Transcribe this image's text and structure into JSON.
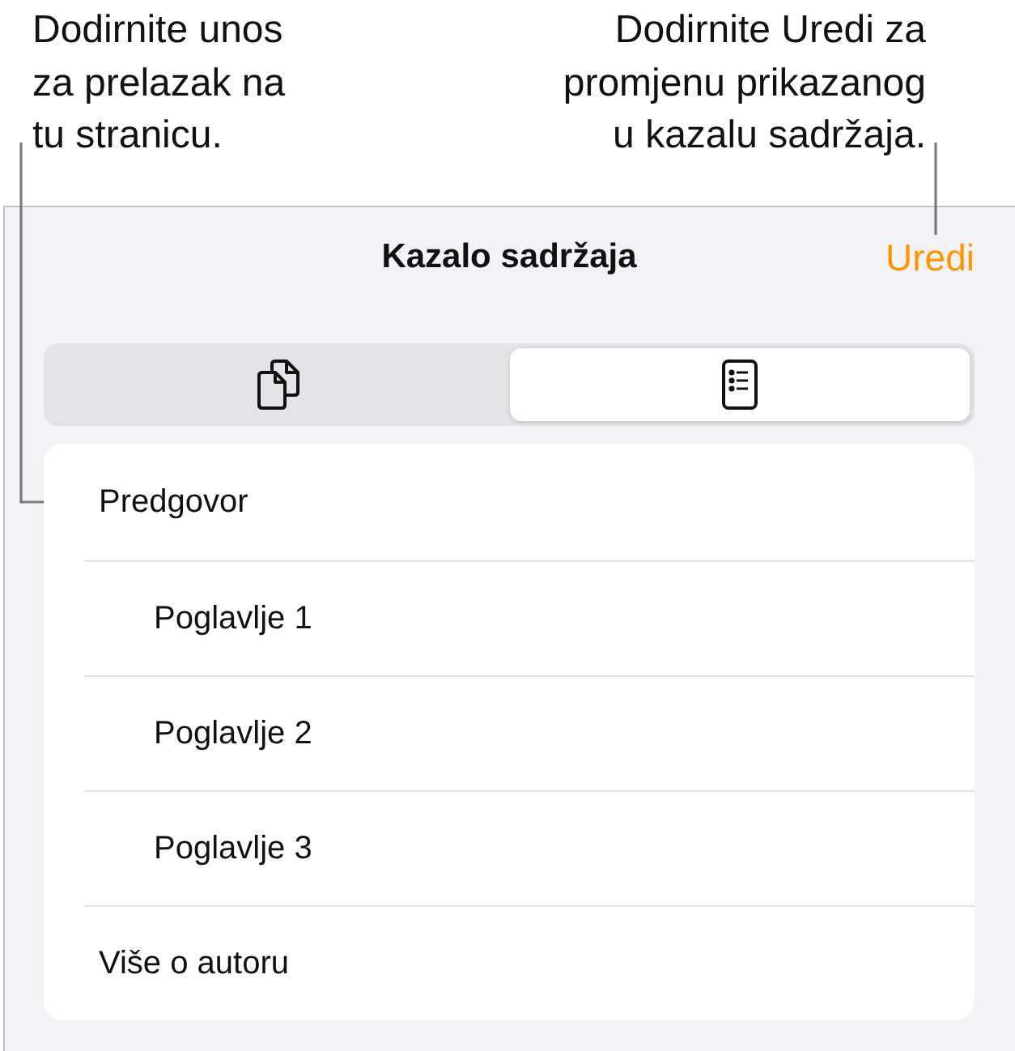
{
  "callouts": [
    {
      "text": "Dodirnite unos\nza prelazak na\ntu stranicu."
    },
    {
      "text": "Dodirnite Uredi za\npromjenu prikazanog\nu kazalu sadržaja."
    }
  ],
  "header": {
    "title": "Kazalo sadržaja",
    "edit_button": "Uredi"
  },
  "view_switcher": [
    {
      "selected": false
    },
    {
      "selected": true
    }
  ],
  "contents": [
    {
      "label": "Predgovor",
      "children": [
        {
          "label": "Poglavlje 1"
        },
        {
          "label": "Poglavlje 2"
        },
        {
          "label": "Poglavlje 3"
        }
      ]
    },
    {
      "label": "Više o autoru"
    }
  ]
}
